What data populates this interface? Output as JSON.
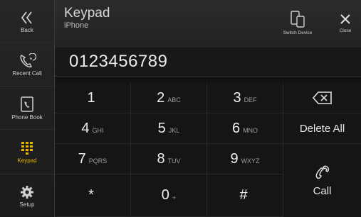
{
  "sidebar": {
    "items": [
      {
        "label": "Back",
        "icon": "back-chevron-icon"
      },
      {
        "label": "Recent Call",
        "icon": "recent-call-icon"
      },
      {
        "label": "Phone Book",
        "icon": "phone-book-icon"
      },
      {
        "label": "Keypad",
        "icon": "keypad-icon",
        "active": true
      },
      {
        "label": "Setup",
        "icon": "gear-icon"
      }
    ]
  },
  "header": {
    "title": "Keypad",
    "subtitle": "iPhone",
    "switch_device_label": "Switch Device",
    "close_label": "Close"
  },
  "dial": {
    "number": "0123456789"
  },
  "keypad": {
    "keys": [
      {
        "digit": "1",
        "letters": ""
      },
      {
        "digit": "2",
        "letters": "ABC"
      },
      {
        "digit": "3",
        "letters": "DEF"
      },
      {
        "digit": "4",
        "letters": "GHI"
      },
      {
        "digit": "5",
        "letters": "JKL"
      },
      {
        "digit": "6",
        "letters": "MNO"
      },
      {
        "digit": "7",
        "letters": "PQRS"
      },
      {
        "digit": "8",
        "letters": "TUV"
      },
      {
        "digit": "9",
        "letters": "WXYZ"
      },
      {
        "digit": "*",
        "letters": ""
      },
      {
        "digit": "0",
        "letters": "+"
      },
      {
        "digit": "#",
        "letters": ""
      }
    ]
  },
  "actions": {
    "delete_all_label": "Delete All",
    "call_label": "Call"
  },
  "colors": {
    "accent": "#e7b400",
    "background": "#131313"
  }
}
